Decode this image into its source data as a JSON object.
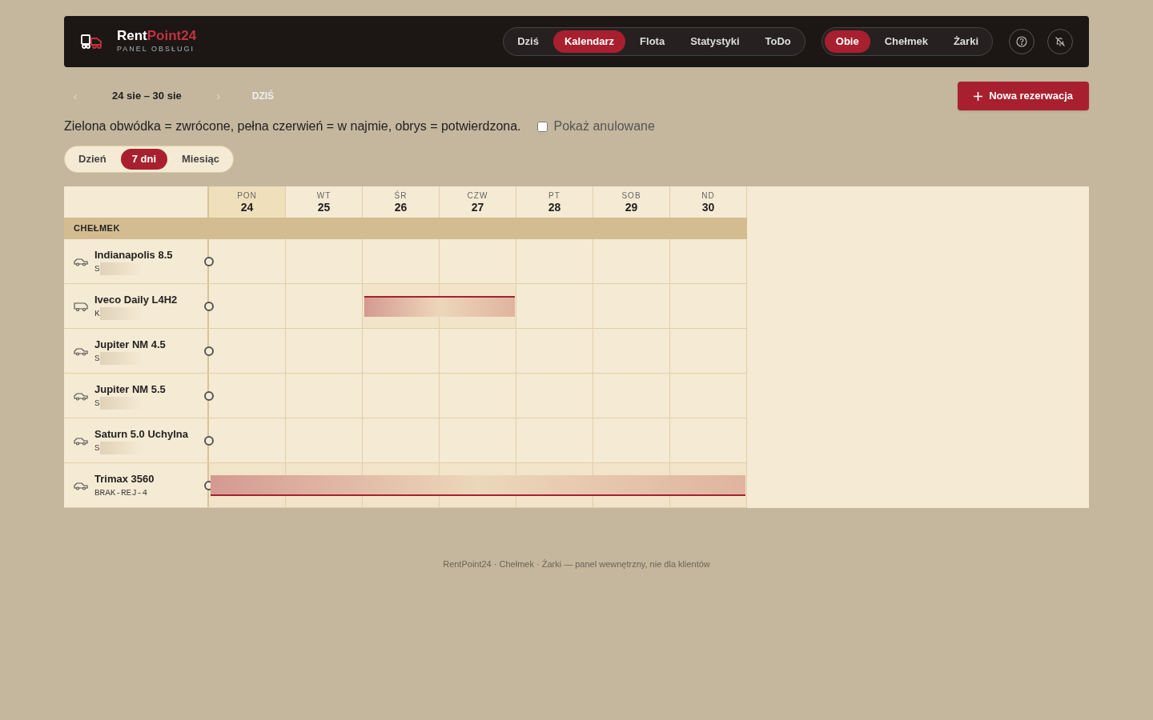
{
  "header": {
    "brand_first": "Rent",
    "brand_second": "Point24",
    "subtitle": "PANEL OBSŁUGI",
    "nav": [
      {
        "label": "Dziś",
        "selected": false
      },
      {
        "label": "Kalendarz",
        "selected": true
      },
      {
        "label": "Flota",
        "selected": false
      },
      {
        "label": "Statystyki",
        "selected": false
      },
      {
        "label": "ToDo",
        "selected": false
      }
    ],
    "locations": [
      {
        "label": "Obie",
        "selected": true
      },
      {
        "label": "Chełmek",
        "selected": false
      },
      {
        "label": "Żarki",
        "selected": false
      }
    ]
  },
  "toolbar": {
    "prev": "‹",
    "range": "24 sie – 30 sie",
    "next": "›",
    "today": "DZIŚ",
    "new_button": "Nowa rezerwacja"
  },
  "legend": "Zielona obwódka = zwrócone, pełna czerwień = w najmie, obrys = potwierdzona.",
  "show_cancelled": {
    "label": "Pokaż anulowane",
    "checked": false
  },
  "views": [
    {
      "label": "Dzień",
      "selected": false
    },
    {
      "label": "7 dni",
      "selected": true
    },
    {
      "label": "Miesiąc",
      "selected": false
    }
  ],
  "calendar": {
    "days": [
      {
        "weekday": "PON",
        "day": "24",
        "today": true
      },
      {
        "weekday": "WT",
        "day": "25",
        "today": false
      },
      {
        "weekday": "ŚR",
        "day": "26",
        "today": false
      },
      {
        "weekday": "CZW",
        "day": "27",
        "today": false
      },
      {
        "weekday": "PT",
        "day": "28",
        "today": false
      },
      {
        "weekday": "SOB",
        "day": "29",
        "today": false
      },
      {
        "weekday": "ND",
        "day": "30",
        "today": false
      }
    ],
    "group": "CHEŁMEK",
    "vehicles": [
      {
        "name": "Indianapolis 8.5",
        "plate": "S",
        "plate_blurred": true,
        "kind": "trailer"
      },
      {
        "name": "Iveco Daily L4H2",
        "plate": "K",
        "plate_blurred": true,
        "kind": "van",
        "booking": {
          "days": [
            false,
            false,
            true,
            true,
            false,
            false,
            false
          ],
          "kind": "outlined"
        }
      },
      {
        "name": "Jupiter NM 4.5",
        "plate": "S",
        "plate_blurred": true,
        "kind": "trailer"
      },
      {
        "name": "Jupiter NM 5.5",
        "plate": "S",
        "plate_blurred": true,
        "kind": "trailer"
      },
      {
        "name": "Saturn 5.0 Uchylna",
        "plate": "S",
        "plate_blurred": true,
        "kind": "trailer"
      },
      {
        "name": "Trimax 3560",
        "plate": "BRAK-REJ-4",
        "plate_blurred": false,
        "kind": "trailer",
        "booking": {
          "days": [
            true,
            true,
            true,
            true,
            true,
            true,
            true
          ],
          "kind": "underlined"
        }
      }
    ]
  },
  "footer": "RentPoint24 · Chełmek · Żarki — panel wewnętrzny, nie dla klientów"
}
